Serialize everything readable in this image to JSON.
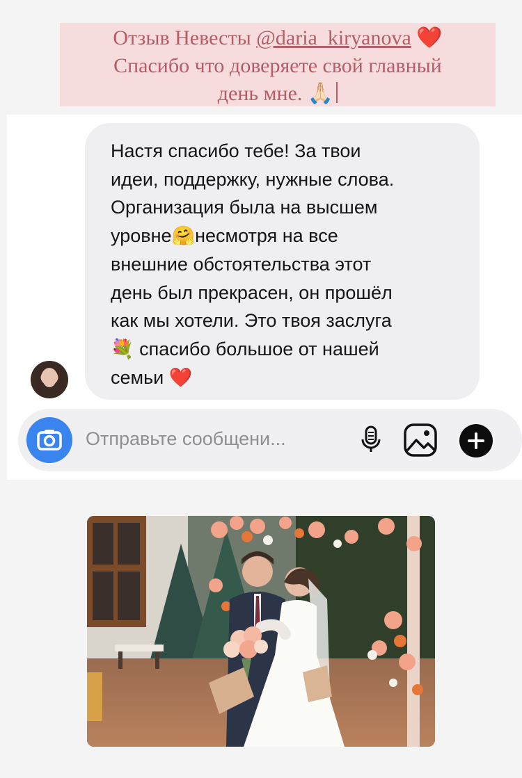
{
  "caption": {
    "prefix": "Отзыв Невесты ",
    "handle": "@daria_kiryanova",
    "heart": "❤️",
    "line2": "Спасибо что доверяете  свой главный",
    "line3": "день мне.",
    "hands": "🙏🏻"
  },
  "message": {
    "lines": [
      "Настя спасибо тебе! За твои",
      "идеи, поддержку, нужные слова.",
      "Организация была на высшем",
      "уровне",
      "несмотря на все",
      "внешние обстоятельства этот",
      "день был прекрасен, он прошёл",
      "как мы хотели. Это твоя заслуга",
      "спасибо большое от нашей",
      "семьи"
    ],
    "emoji_hug": "🤗",
    "emoji_flowers": "💐",
    "emoji_heart": "❤️"
  },
  "composer": {
    "placeholder": "Отправьте сообщени..."
  },
  "icons": {
    "camera": "camera-icon",
    "mic": "microphone-icon",
    "gallery": "gallery-icon",
    "plus": "plus-icon"
  },
  "colors": {
    "caption_bg": "#f6dcdd",
    "caption_text": "#b55d66",
    "camera_button": "#3a84f0",
    "bubble_bg": "#efeff1"
  }
}
